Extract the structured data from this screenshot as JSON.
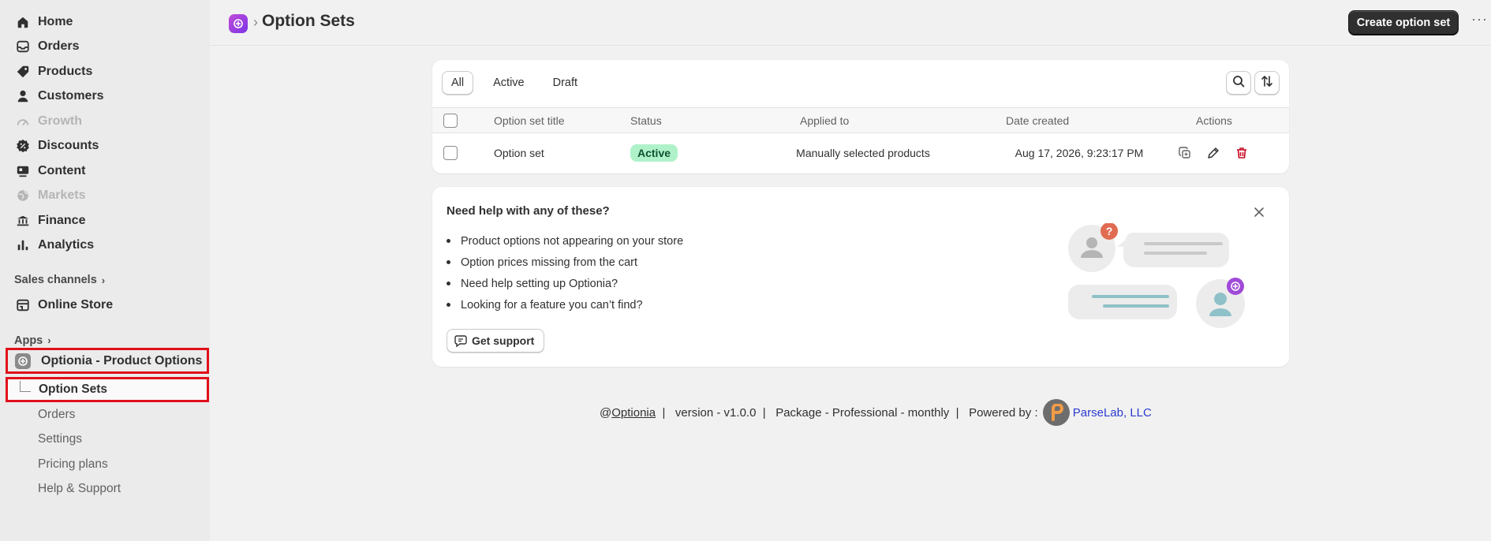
{
  "sidebar": {
    "nav": [
      {
        "label": "Home",
        "icon": "home-icon",
        "disabled": false
      },
      {
        "label": "Orders",
        "icon": "inbox-icon",
        "disabled": false
      },
      {
        "label": "Products",
        "icon": "tag-icon",
        "disabled": false
      },
      {
        "label": "Customers",
        "icon": "person-icon",
        "disabled": false
      },
      {
        "label": "Growth",
        "icon": "gauge-icon",
        "disabled": true
      },
      {
        "label": "Discounts",
        "icon": "discount-icon",
        "disabled": false
      },
      {
        "label": "Content",
        "icon": "content-icon",
        "disabled": false
      },
      {
        "label": "Markets",
        "icon": "globe-icon",
        "disabled": true
      },
      {
        "label": "Finance",
        "icon": "bank-icon",
        "disabled": false
      },
      {
        "label": "Analytics",
        "icon": "bar-chart-icon",
        "disabled": false
      }
    ],
    "sales_channels_label": "Sales channels",
    "online_store_label": "Online Store",
    "apps_label": "Apps",
    "app_name": "Optionia - Product Options",
    "app_sub_items": [
      "Option Sets",
      "Orders",
      "Settings",
      "Pricing plans",
      "Help & Support"
    ]
  },
  "header": {
    "title": "Option Sets",
    "create_button": "Create option set",
    "more": "···"
  },
  "table": {
    "tabs": [
      "All",
      "Active",
      "Draft"
    ],
    "columns": [
      "Option set title",
      "Status",
      "Applied to",
      "Date created",
      "Actions"
    ],
    "rows": [
      {
        "title": "Option set",
        "status": "Active",
        "applied_to": "Manually selected products",
        "date_created": "Aug 17, 2026, 9:23:17 PM"
      }
    ]
  },
  "help": {
    "title": "Need help with any of these?",
    "items": [
      "Product options not appearing on your store",
      "Option prices missing from the cart",
      "Need help setting up Optionia?",
      "Looking for a feature you can’t find?"
    ],
    "support_button": "Get support"
  },
  "footer": {
    "brand": "Optionia",
    "at": "@",
    "version": "version - v1.0.0",
    "package": "Package - Professional - monthly",
    "powered_by": "Powered by :",
    "company": "ParseLab, LLC",
    "sep": "|"
  },
  "colors": {
    "accent_dark": "#303030",
    "badge_green": "#aff2c9",
    "delete_red": "#c70a24",
    "highlight_red": "#e0101b",
    "link_blue": "#2c3bd1"
  }
}
